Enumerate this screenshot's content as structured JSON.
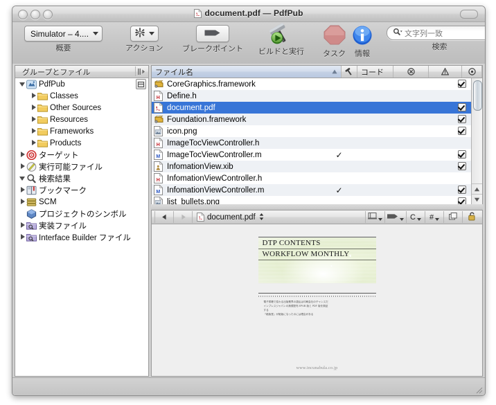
{
  "window": {
    "title": "document.pdf — PdfPub",
    "title_icon": "pdf-document-icon",
    "traffic_lights": [
      "close-button",
      "minimize-button",
      "zoom-button"
    ]
  },
  "toolbar": {
    "overview": {
      "value": "Simulator – 4....",
      "label": "概要",
      "icon": "popup-caret-icon"
    },
    "action": {
      "label": "アクション",
      "icon": "gear-icon"
    },
    "breakpoint": {
      "label": "ブレークポイント",
      "icon": "breakpoint-flag-icon"
    },
    "build_and_run": {
      "label": "ビルドと実行",
      "icon": "hammer-run-icon"
    },
    "tasks": {
      "label": "タスク",
      "icon": "stop-octagon-icon"
    },
    "info": {
      "label": "情報",
      "icon": "info-circle-icon"
    },
    "search": {
      "label": "検索",
      "placeholder": "文字列一致",
      "value": "",
      "icon": "search-magnifier-icon"
    }
  },
  "sidebar": {
    "header": "グループとファイル",
    "items": [
      {
        "label": "PdfPub",
        "icon": "xcode-project-icon",
        "indent": 0,
        "disclosure": "open",
        "bold": false
      },
      {
        "label": "Classes",
        "icon": "folder-icon",
        "indent": 1,
        "disclosure": "closed",
        "bold": false
      },
      {
        "label": "Other Sources",
        "icon": "folder-icon",
        "indent": 1,
        "disclosure": "closed",
        "bold": false
      },
      {
        "label": "Resources",
        "icon": "folder-icon",
        "indent": 1,
        "disclosure": "closed",
        "bold": false
      },
      {
        "label": "Frameworks",
        "icon": "folder-icon",
        "indent": 1,
        "disclosure": "closed",
        "bold": false
      },
      {
        "label": "Products",
        "icon": "folder-icon",
        "indent": 1,
        "disclosure": "closed",
        "bold": false
      },
      {
        "label": "ターゲット",
        "icon": "target-icon",
        "indent": 0,
        "disclosure": "closed",
        "bold": false
      },
      {
        "label": "実行可能ファイル",
        "icon": "executable-icon",
        "indent": 0,
        "disclosure": "closed",
        "bold": false
      },
      {
        "label": "検索結果",
        "icon": "magnifier-icon",
        "indent": 0,
        "disclosure": "open",
        "bold": false
      },
      {
        "label": "ブックマーク",
        "icon": "bookmark-book-icon",
        "indent": 0,
        "disclosure": "closed",
        "bold": false
      },
      {
        "label": "SCM",
        "icon": "scm-database-icon",
        "indent": 0,
        "disclosure": "closed",
        "bold": false
      },
      {
        "label": "プロジェクトのシンボル",
        "icon": "symbols-cube-icon",
        "indent": 0,
        "disclosure": "none",
        "bold": false
      },
      {
        "label": "実装ファイル",
        "icon": "smart-folder-icon",
        "indent": 0,
        "disclosure": "closed",
        "bold": false
      },
      {
        "label": "Interface Builder ファイル",
        "icon": "smart-folder-icon",
        "indent": 0,
        "disclosure": "closed",
        "bold": false
      }
    ]
  },
  "file_table": {
    "columns": [
      {
        "label": "ファイル名",
        "icon": "",
        "sorted": true,
        "sort_dir": "asc"
      },
      {
        "label": "",
        "icon": "hammer-icon",
        "sorted": false
      },
      {
        "label": "コード",
        "icon": "",
        "sorted": false
      },
      {
        "label": "",
        "icon": "error-circle-icon",
        "sorted": false
      },
      {
        "label": "",
        "icon": "warning-triangle-icon",
        "sorted": false
      },
      {
        "label": "",
        "icon": "target-small-icon",
        "sorted": false
      }
    ],
    "rows": [
      {
        "name": "CoreGraphics.framework",
        "icon": "framework-icon",
        "built": "",
        "code": "",
        "errors": "",
        "warnings": "",
        "target": true,
        "selected": false
      },
      {
        "name": "Define.h",
        "icon": "header-file-icon",
        "built": "",
        "code": "",
        "errors": "",
        "warnings": "",
        "target": false,
        "selected": false
      },
      {
        "name": "document.pdf",
        "icon": "pdf-file-icon",
        "built": "",
        "code": "",
        "errors": "",
        "warnings": "",
        "target": true,
        "selected": true
      },
      {
        "name": "Foundation.framework",
        "icon": "framework-icon",
        "built": "",
        "code": "",
        "errors": "",
        "warnings": "",
        "target": true,
        "selected": false
      },
      {
        "name": "icon.png",
        "icon": "image-file-icon",
        "built": "",
        "code": "",
        "errors": "",
        "warnings": "",
        "target": true,
        "selected": false
      },
      {
        "name": "ImageTocViewController.h",
        "icon": "header-file-icon",
        "built": "",
        "code": "",
        "errors": "",
        "warnings": "",
        "target": false,
        "selected": false
      },
      {
        "name": "ImageTocViewController.m",
        "icon": "source-file-icon",
        "built": "✓",
        "code": "",
        "errors": "",
        "warnings": "",
        "target": true,
        "selected": false
      },
      {
        "name": "InfomationView.xib",
        "icon": "xib-file-icon",
        "built": "",
        "code": "",
        "errors": "",
        "warnings": "",
        "target": true,
        "selected": false
      },
      {
        "name": "InfomationViewController.h",
        "icon": "header-file-icon",
        "built": "",
        "code": "",
        "errors": "",
        "warnings": "",
        "target": false,
        "selected": false
      },
      {
        "name": "InfomationViewController.m",
        "icon": "source-file-icon",
        "built": "✓",
        "code": "",
        "errors": "",
        "warnings": "",
        "target": true,
        "selected": false
      },
      {
        "name": "list_bullets.png",
        "icon": "image-file-icon",
        "built": "",
        "code": "",
        "errors": "",
        "warnings": "",
        "target": true,
        "selected": false
      }
    ]
  },
  "pdf_pane": {
    "back_icon": "back-arrow-icon",
    "forward_icon": "forward-arrow-icon",
    "document_name": "document.pdf",
    "document_icon": "pdf-document-icon",
    "popup_indicator": "up-down-arrows-icon",
    "right_buttons": [
      {
        "icon": "bookshelf-icon",
        "label": "",
        "caret": true
      },
      {
        "icon": "bookmark-icon",
        "label": "",
        "caret": true
      },
      {
        "icon": "",
        "label": "C",
        "caret": true
      },
      {
        "icon": "",
        "label": "#",
        "caret": true
      },
      {
        "icon": "split-editor-icon",
        "label": "",
        "caret": false
      },
      {
        "icon": "lock-open-icon",
        "label": "",
        "caret": false
      }
    ],
    "page": {
      "title_line1": "DTP CONTENTS",
      "title_line2": "WORKFLOW MONTHLY",
      "body_lines": [
        "電子書籍で変わる出版業界の激乱は印刷会社のチャンスだ",
        "インプレスジャパンの無償配布 EPUB 版と PDF 版を検証",
        "する",
        "「絶版堂」が絶版になったのには理由がある"
      ],
      "footer_url": "www.incunabula.co.jp"
    }
  },
  "colors": {
    "selection_blue": "#3875d7",
    "sorted_header": "#c4d1e5",
    "stripe": "#eef1f5",
    "pdf_red": "#c4262e",
    "header_green": "#dde9c2"
  }
}
